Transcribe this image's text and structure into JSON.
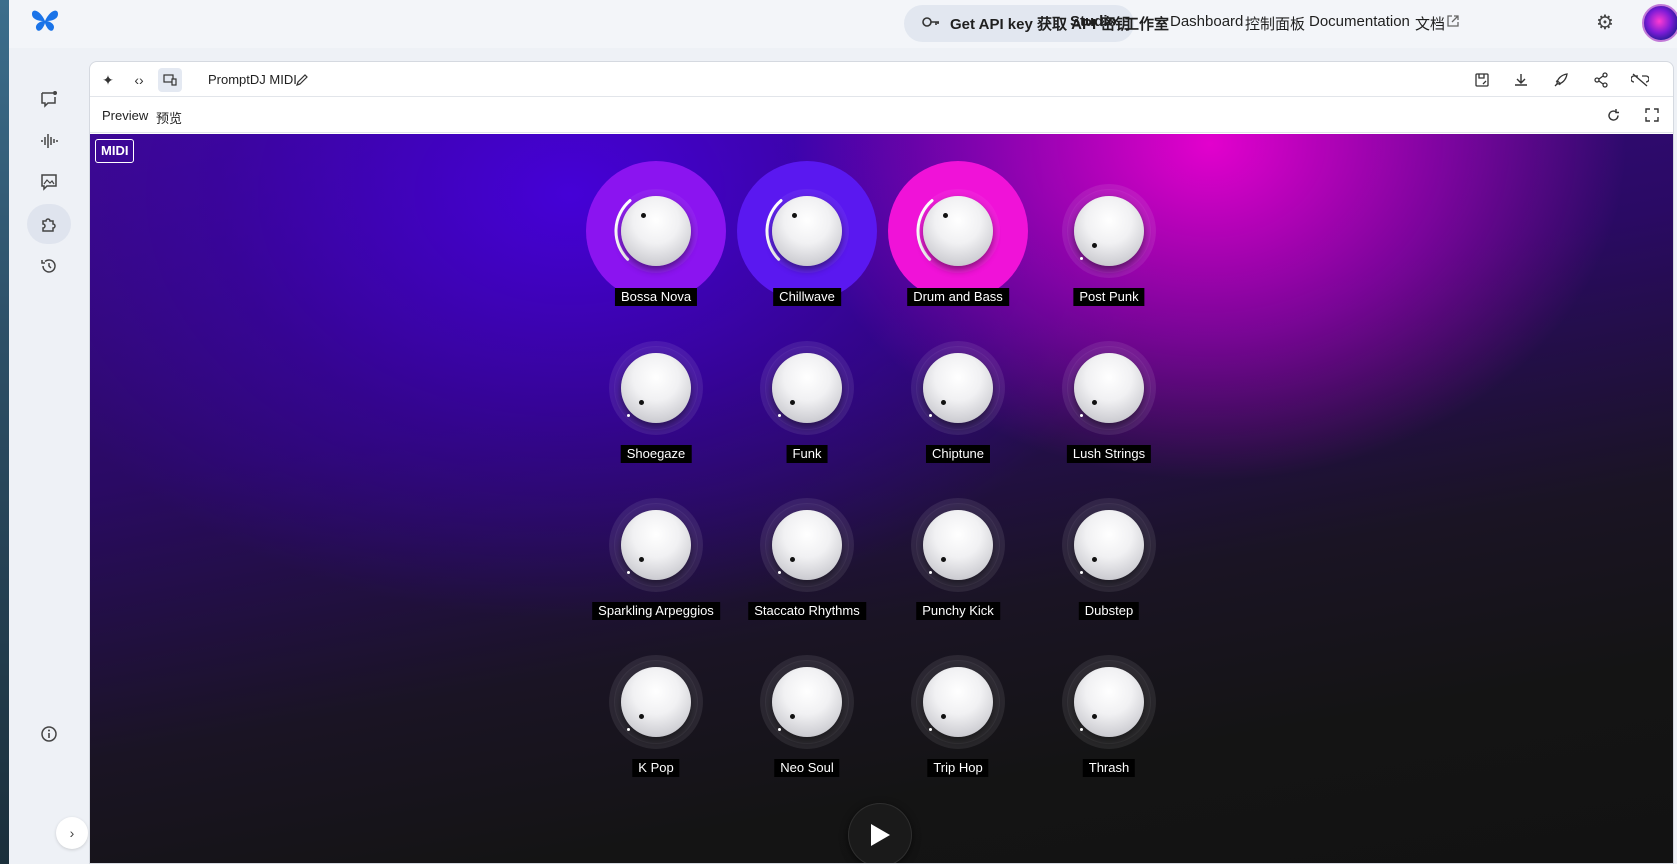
{
  "topbar": {
    "api_key": "Get API key  获取 API 密钥",
    "nav": [
      "Studio",
      "工作室",
      "Dashboard",
      "控制面板",
      "Documentation",
      "文档"
    ]
  },
  "toolbar": {
    "app_title": "PromptDJ MIDI"
  },
  "preview": {
    "label_en": "Preview",
    "label_zh": "预览"
  },
  "stage": {
    "midi_badge": "MIDI",
    "knobs": [
      {
        "label": "Bossa Nova",
        "active": true,
        "halo": "#8b14f0",
        "level": 0.35
      },
      {
        "label": "Chillwave",
        "active": true,
        "halo": "#5a18f0",
        "level": 0.35
      },
      {
        "label": "Drum and Bass",
        "active": true,
        "halo": "#f012d8",
        "level": 0.35
      },
      {
        "label": "Post Punk",
        "active": false,
        "level": 0.0
      },
      {
        "label": "Shoegaze",
        "active": false,
        "level": 0.0
      },
      {
        "label": "Funk",
        "active": false,
        "level": 0.0
      },
      {
        "label": "Chiptune",
        "active": false,
        "level": 0.0
      },
      {
        "label": "Lush Strings",
        "active": false,
        "level": 0.0
      },
      {
        "label": "Sparkling Arpeggios",
        "active": false,
        "level": 0.0
      },
      {
        "label": "Staccato Rhythms",
        "active": false,
        "level": 0.0
      },
      {
        "label": "Punchy Kick",
        "active": false,
        "level": 0.0
      },
      {
        "label": "Dubstep",
        "active": false,
        "level": 0.0
      },
      {
        "label": "K Pop",
        "active": false,
        "level": 0.0
      },
      {
        "label": "Neo Soul",
        "active": false,
        "level": 0.0
      },
      {
        "label": "Trip Hop",
        "active": false,
        "level": 0.0
      },
      {
        "label": "Thrash",
        "active": false,
        "level": 0.0
      }
    ]
  },
  "colors": {
    "accent_blue": "#1a73e8",
    "stage_top": "#3c0a8c",
    "stage_bottom": "#121212"
  }
}
